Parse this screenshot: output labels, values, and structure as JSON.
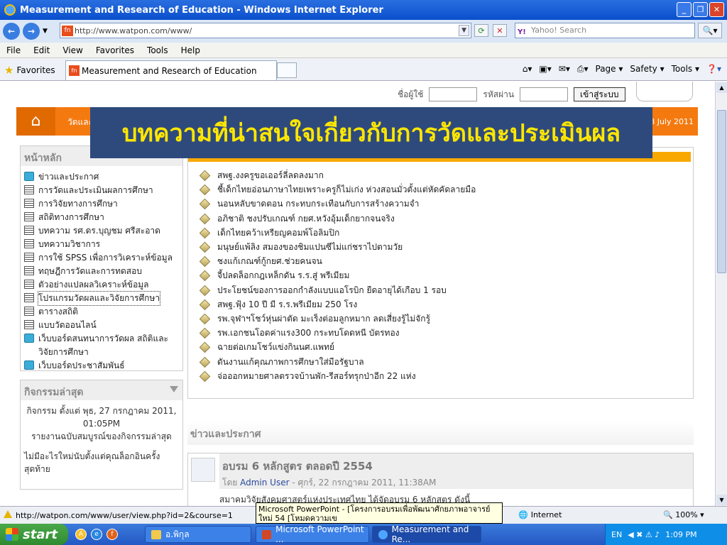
{
  "window": {
    "title": "Measurement and Research of Education - Windows Internet Explorer"
  },
  "addressbar": {
    "url": "http://www.watpon.com/www/",
    "search_placeholder": "Yahoo! Search",
    "search_brand": "Y!"
  },
  "menubar": [
    "File",
    "Edit",
    "View",
    "Favorites",
    "Tools",
    "Help"
  ],
  "favbar": {
    "favorites_label": "Favorites",
    "tab_title": "Measurement and Research of Education",
    "commands": [
      "Page ▾",
      "Safety ▾",
      "Tools ▾"
    ]
  },
  "login": {
    "username_label": "ชื่อผู้ใช้",
    "password_label": "รหัสผ่าน",
    "submit_label": "เข้าสู่ระบบ"
  },
  "header": {
    "crumb": "วัดและ",
    "date": "28 July 2011"
  },
  "overlay": {
    "title": "บทความที่น่าสนใจเกี่ยวกับการวัดและประเมินผล"
  },
  "mainmenu": {
    "title": "หน้าหลัก",
    "items": [
      {
        "label": "ข่าวและประกาศ",
        "icon": "chat"
      },
      {
        "label": "การวัดและประเมินผลการศึกษา",
        "icon": "doc"
      },
      {
        "label": "การวิจัยทางการศึกษา",
        "icon": "doc"
      },
      {
        "label": "สถิติทางการศึกษา",
        "icon": "doc"
      },
      {
        "label": "บทความ รศ.ดร.บุญชม ศรีสะอาด",
        "icon": "doc"
      },
      {
        "label": "บทความวิชาการ",
        "icon": "doc"
      },
      {
        "label": "การใช้ SPSS เพื่อการวิเคราะห์ข้อมูล",
        "icon": "doc"
      },
      {
        "label": "ทฤษฎีการวัดและการทดสอบ",
        "icon": "doc"
      },
      {
        "label": "ตัวอย่างแปลผลวิเคราะห์ข้อมูล",
        "icon": "doc"
      },
      {
        "label": "โปรแกรมวัดผลและวิจัยการศึกษา",
        "icon": "doc"
      },
      {
        "label": "ตารางสถิติ",
        "icon": "doc"
      },
      {
        "label": "แบบวัดออนไลน์",
        "icon": "doc"
      },
      {
        "label": "เว็บบอร์ดสนทนาการวัดผล สถิติและวิจัยการศึกษา",
        "icon": "chat"
      },
      {
        "label": "เว็บบอร์ดประชาสัมพันธ์",
        "icon": "chat"
      }
    ]
  },
  "activity": {
    "title": "กิจกรรมล่าสุด",
    "since": "กิจกรรม ตั้งแต่ พุธ, 27 กรกฎาคม 2011, 01:05PM",
    "report": "รายงานฉบับสมบูรณ์ของกิจกรรมล่าสุด",
    "note": "ไม่มีอะไรใหม่นับตั้งแต่คุณล็อกอินครั้งสุดท้าย"
  },
  "articles": [
    "สพฐ.งงครูขอเออร์ลี่ลดลงมาก",
    "ชี้เด็กไทยอ่อนภาษาไทยเพราะครูก็ไม่เก่ง ห่วงสอนมั่วตั้งแต่หัดคัดลายมือ",
    "นอนหลับขาดตอน กระทบกระเทือนกับการสร้างความจำ",
    "อภิชาติ ชงปรับเกณฑ์ กยศ.หวังอุ้มเด็กยากจนจริง",
    "เด็กไทยคว้าเหรียญคอมพ์โอลิมปิก",
    "มนุษย์แพ้ลิง สมองของชิมแปนซีไม่แก่ชราไปตามวัย",
    "ชงแก้เกณฑ์กู้กยศ.ช่วยคนจน",
    "จี้ปลดล็อกกฎเหล็กดัน ร.ร.สู่ พรีเมียม",
    "ประโยชน์ของการออกกำลังแบบแอโรบิก ยืดอายุได้เกือบ 1 รอบ",
    "สพฐ.ฟุ้ง 10 ปี มี ร.ร.พรีเมียม 250 โรง",
    "รพ.จุฬาฯโชว์หุ่นผ่าตัด มะเร็งต่อมลูกหมาก ลดเสี่ยงรู้ไม่จักรู้",
    "รพ.เอกชนโอดค่าแรง300 กระทบโดดหนี บัตรทอง",
    "ฉายต่อเกมโชว์แข่งกินนศ.แพทย์",
    "ดันงานแก้คุณภาพการศึกษาใส่มือรัฐบาล",
    "จ่อออกหมายศาลตรวจบ้านพัก-รีสอร์ทรุกป่าอีก 22 แห่ง"
  ],
  "news": {
    "title": "ข่าวและประกาศ",
    "post_title": "อบรม 6 หลักสูตร ตลอดปี 2554",
    "post_by_prefix": "โดย",
    "post_author": "Admin User",
    "post_date": "- ศุกร์, 22 กรกฎาคม 2011, 11:38AM",
    "post_body": "สมาคมวิจัยสังคมศาสตร์แห่งประเทศไทย ได้จัดอบรม 6 หลักสูตร ดังนี้"
  },
  "statusbar": {
    "url": "http://watpon.com/www/user/view.php?id=2&course=1",
    "zone": "Internet",
    "zoom": "100%"
  },
  "tooltip": {
    "text": "Microsoft PowerPoint - [โครงการอบรมเพื่อพัฒนาศักยภาพอาจารย์ใหม่ 54 [โหมดความเข"
  },
  "taskbar": {
    "start": "start",
    "buttons": [
      "อ.พิกุล",
      "Microsoft PowerPoint ...",
      "Measurement and Re..."
    ],
    "lang": "EN",
    "clock": "1:09 PM"
  },
  "colors": {
    "accent_orange": "#f47a10",
    "overlay_bg": "#2e4a7d",
    "overlay_text": "#ffe600"
  }
}
